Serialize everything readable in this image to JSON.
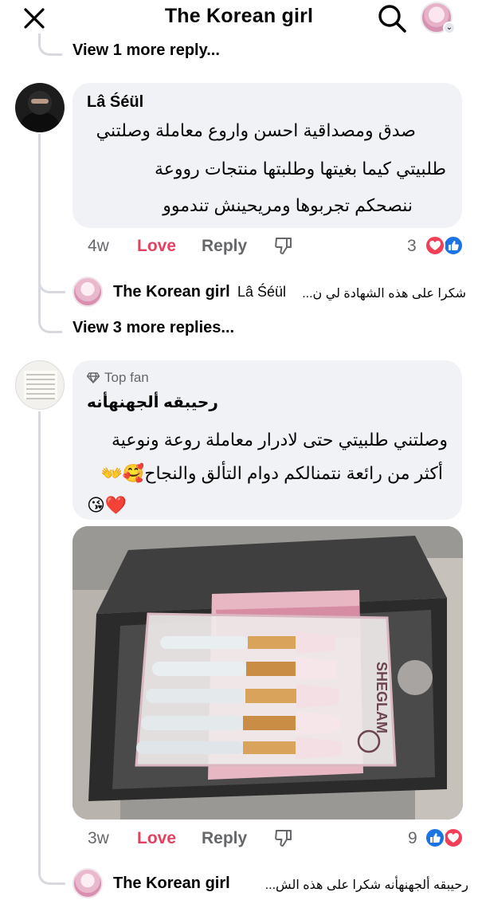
{
  "header": {
    "title": "The Korean girl"
  },
  "thread": {
    "view_more_1": "View 1 more reply...",
    "view_more_2": "View 3 more replies..."
  },
  "comments": [
    {
      "author": "Lâ Śéül",
      "lines": [
        "صدق ومصداقية احسن واروع معاملة  وصلتني",
        "طلبيتي كيما بغيتها وطلبتها منتجات رووعة",
        "ننصحكم تجربوها ومريحينش تندموو"
      ],
      "time": "4w",
      "love_label": "Love",
      "reply_label": "Reply",
      "reaction_count": "3"
    },
    {
      "badge": "Top fan",
      "author": "رحيبقه ألجهنهأنه",
      "lines": [
        "وصلتني طلبيتي حتى لادرار معاملة روعة ونوعية",
        "أكثر من رائعة نتمنالكم دوام التألق والنجاح🥰👐",
        "😘❤️"
      ],
      "time": "3w",
      "love_label": "Love",
      "reply_label": "Reply",
      "reaction_count": "9"
    }
  ],
  "replies": [
    {
      "name": "The Korean girl",
      "mention": "Lâ Śéül",
      "text": "شكرا على هذه الشهادة لي ن..."
    },
    {
      "name": "The Korean girl",
      "text": "رحيبقه ألجهنهأنه شكرا على هذه الش..."
    }
  ],
  "photo": {
    "brand_text": "SHEGLAM"
  },
  "colors": {
    "love": "#e4405f",
    "like": "#1b74e4",
    "bubble": "#f0f2f5",
    "muted": "#65676b"
  }
}
